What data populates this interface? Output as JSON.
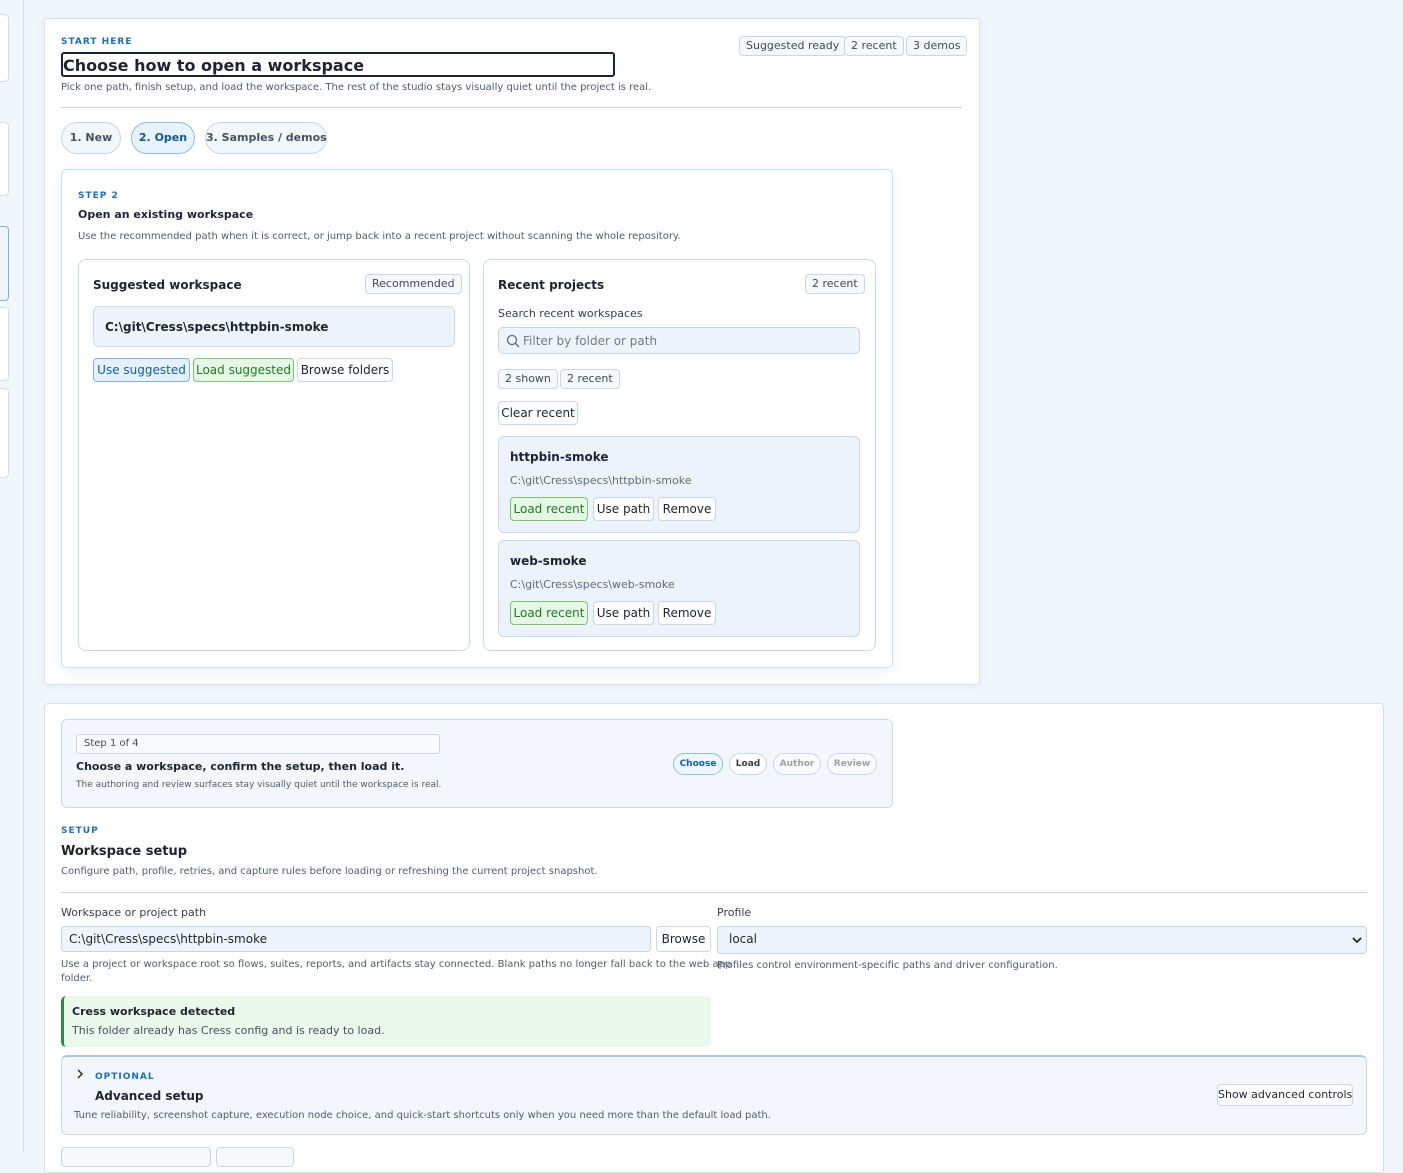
{
  "start": {
    "eyebrow": "START HERE",
    "title": "Choose how to open a workspace",
    "subtitle": "Pick one path, finish setup, and load the workspace. The rest of the studio stays visually quiet until the project is real.",
    "chips": [
      "Suggested ready",
      "2 recent",
      "3 demos"
    ],
    "tabs": [
      {
        "label": "1. New",
        "active": false
      },
      {
        "label": "2. Open",
        "active": true
      },
      {
        "label": "3. Samples / demos",
        "active": false
      }
    ]
  },
  "step": {
    "eyebrow": "STEP 2",
    "title": "Open an existing workspace",
    "subtitle": "Use the recommended path when it is correct, or jump back into a recent project without scanning the whole repository."
  },
  "suggested": {
    "title": "Suggested workspace",
    "badge": "Recommended",
    "path": "C:\\git\\Cress\\specs\\httpbin-smoke",
    "use_label": "Use suggested",
    "load_label": "Load suggested",
    "browse_label": "Browse folders"
  },
  "recent": {
    "title": "Recent projects",
    "badge": "2 recent",
    "search_label": "Search recent workspaces",
    "search_placeholder": "Filter by folder or path",
    "shown_chip": "2 shown",
    "recent_chip": "2 recent",
    "clear_label": "Clear recent",
    "load_label": "Load recent",
    "use_label": "Use path",
    "remove_label": "Remove",
    "items": [
      {
        "name": "httpbin-smoke",
        "path": "C:\\git\\Cress\\specs\\httpbin-smoke"
      },
      {
        "name": "web-smoke",
        "path": "C:\\git\\Cress\\specs\\web-smoke"
      }
    ]
  },
  "stepper": {
    "counter": "Step 1 of 4",
    "title": "Choose a workspace, confirm the setup, then load it.",
    "subtitle": "The authoring and review surfaces stay visually quiet until the workspace is real.",
    "steps": [
      {
        "label": "Choose",
        "state": "active"
      },
      {
        "label": "Load",
        "state": "normal"
      },
      {
        "label": "Author",
        "state": "muted"
      },
      {
        "label": "Review",
        "state": "muted"
      }
    ]
  },
  "setup": {
    "eyebrow": "SETUP",
    "title": "Workspace setup",
    "subtitle": "Configure path, profile, retries, and capture rules before loading or refreshing the current project snapshot.",
    "path_label": "Workspace or project path",
    "path_value": "C:\\git\\Cress\\specs\\httpbin-smoke",
    "browse_label": "Browse",
    "path_help_1": "Use a project or workspace root so flows, suites, reports, and artifacts stay connected. Blank paths no longer fall back to the web app",
    "path_help_2": "folder.",
    "profile_label": "Profile",
    "profile_value": "local",
    "profile_help": "Profiles control environment-specific paths and driver configuration.",
    "detected_title": "Cress workspace detected",
    "detected_text": "This folder already has Cress config and is ready to load."
  },
  "advanced": {
    "eyebrow": "OPTIONAL",
    "title": "Advanced setup",
    "subtitle": "Tune reliability, screenshot capture, execution node choice, and quick-start shortcuts only when you need more than the default load path.",
    "toggle_label": "Show advanced controls"
  }
}
